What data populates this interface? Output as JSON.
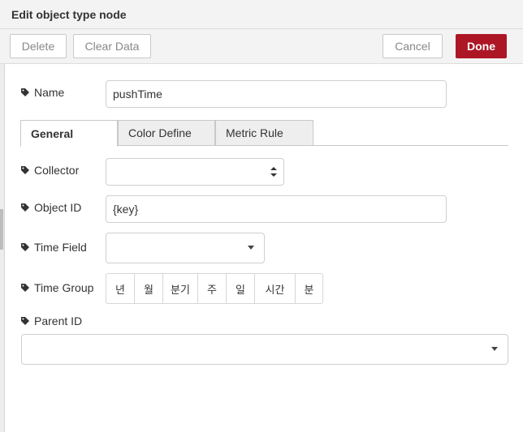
{
  "dialog": {
    "title": "Edit object type node"
  },
  "toolbar": {
    "delete_label": "Delete",
    "clear_label": "Clear Data",
    "cancel_label": "Cancel",
    "done_label": "Done"
  },
  "fields": {
    "name_label": "Name",
    "name_value": "pushTime",
    "collector_label": "Collector",
    "collector_value": "",
    "object_id_label": "Object ID",
    "object_id_value": "{key}",
    "time_field_label": "Time Field",
    "time_field_value": "",
    "time_group_label": "Time Group",
    "parent_id_label": "Parent ID",
    "parent_id_value": ""
  },
  "tabs": [
    {
      "label": "General",
      "active": true
    },
    {
      "label": "Color Define",
      "active": false
    },
    {
      "label": "Metric Rule",
      "active": false
    }
  ],
  "time_group_options": [
    "년",
    "월",
    "분기",
    "주",
    "일",
    "시간",
    "분"
  ],
  "colors": {
    "done_button": "#ad1625",
    "header_bg": "#f3f3f3"
  },
  "icons": {
    "field_tag": "tag-icon",
    "select": "select-arrows-icon",
    "dropdown": "chevron-down-icon"
  }
}
